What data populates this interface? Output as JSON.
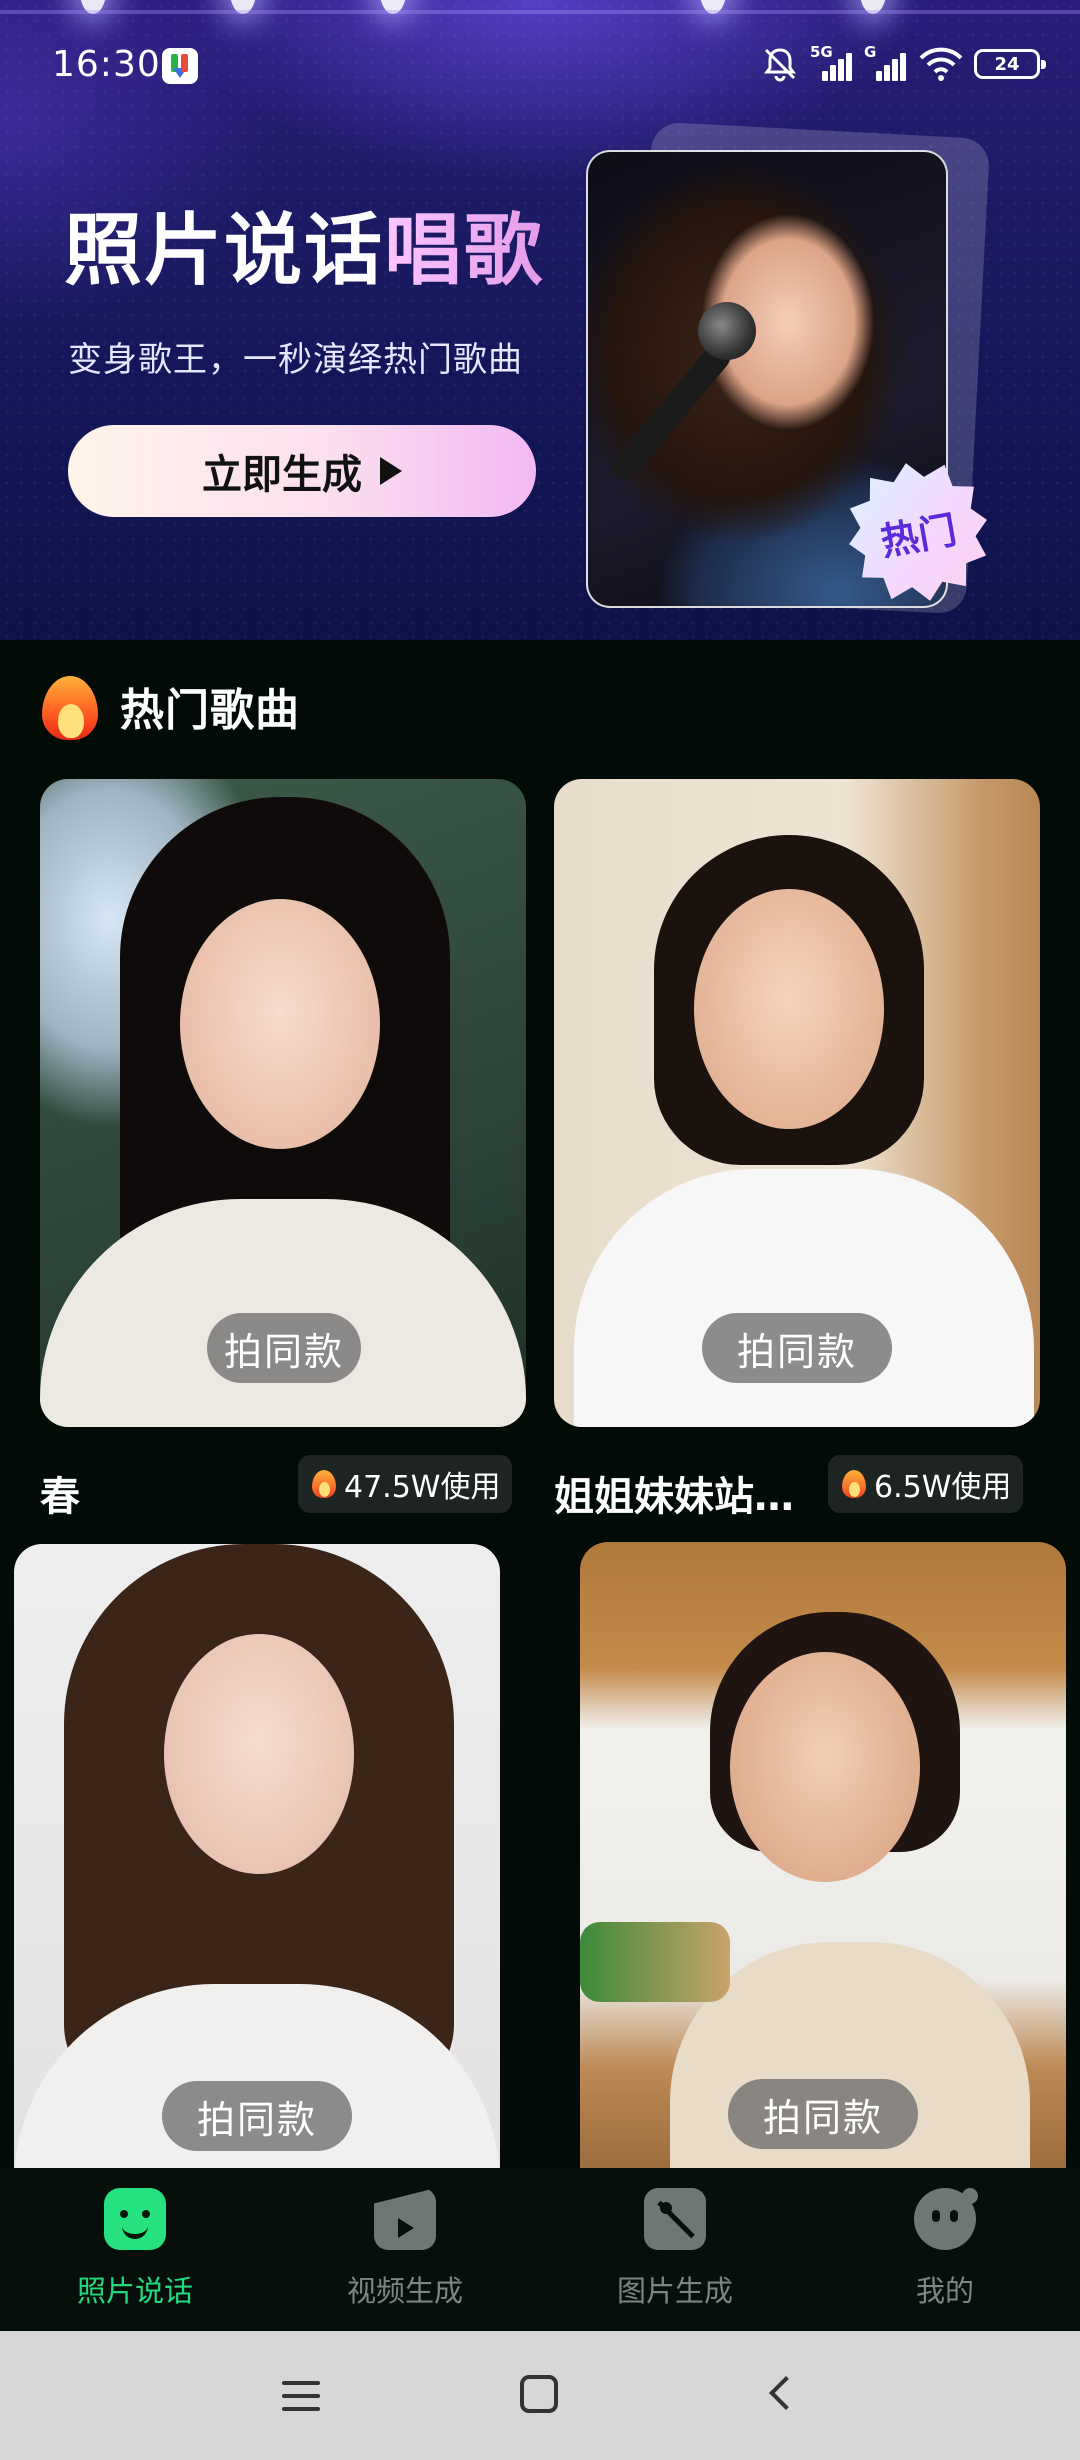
{
  "status_bar": {
    "time": "16:30",
    "network_1": "5G",
    "network_2": "G",
    "battery": "24"
  },
  "banner": {
    "title_part1": "照片说话",
    "title_part2": "唱歌",
    "subtitle": "变身歌王，一秒演绎热门歌曲",
    "button_label": "立即生成",
    "badge": "热门"
  },
  "section": {
    "title": "热门歌曲"
  },
  "cards": [
    {
      "title": "春",
      "usage": "47.5W使用",
      "action": "拍同款"
    },
    {
      "title": "姐姐妹妹站…",
      "usage": "6.5W使用",
      "action": "拍同款"
    },
    {
      "title": "",
      "usage": "",
      "action": "拍同款"
    },
    {
      "title": "",
      "usage": "",
      "action": "拍同款"
    }
  ],
  "tabs": [
    {
      "label": "照片说话",
      "icon": "photo-talk-icon",
      "active": true
    },
    {
      "label": "视频生成",
      "icon": "video-icon",
      "active": false
    },
    {
      "label": "图片生成",
      "icon": "image-icon",
      "active": false
    },
    {
      "label": "我的",
      "icon": "profile-icon",
      "active": false
    }
  ],
  "colors": {
    "accent": "#23d97d",
    "background": "#030b07",
    "banner": "#1b1a63"
  }
}
